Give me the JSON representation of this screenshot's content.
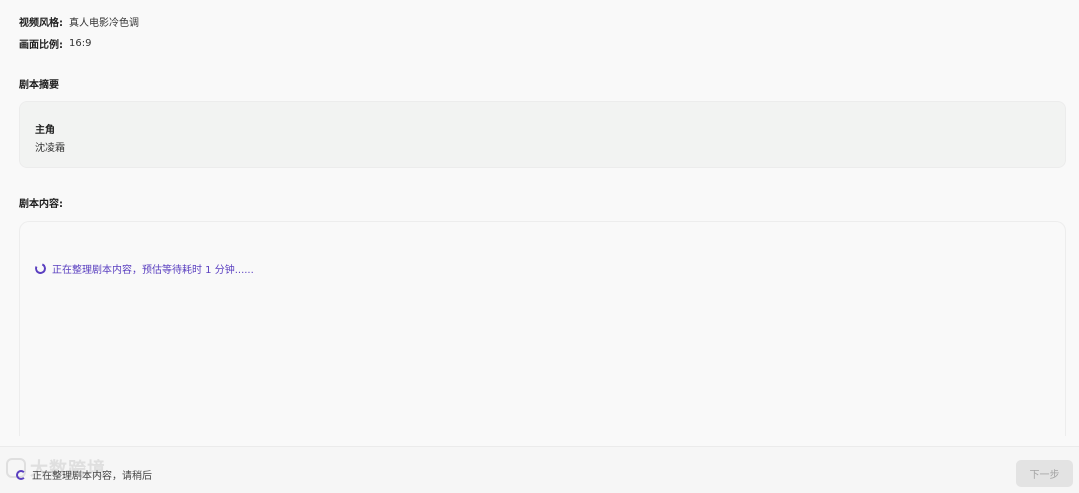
{
  "meta": {
    "style_label": "视频风格:",
    "style_value": "真人电影冷色调",
    "ratio_label": "画面比例:",
    "ratio_value": "16:9"
  },
  "summary": {
    "title": "剧本摘要",
    "protagonist_label": "主角",
    "protagonist_value": "沈凌霜"
  },
  "content": {
    "title": "剧本内容:",
    "loading_text": "正在整理剧本内容，预估等待耗时 1 分钟......"
  },
  "footer": {
    "status_text": "正在整理剧本内容，请稍后",
    "watermark_text": "大数跨境",
    "next_label": "下一步",
    "accent_color": "#5a3fc0"
  }
}
